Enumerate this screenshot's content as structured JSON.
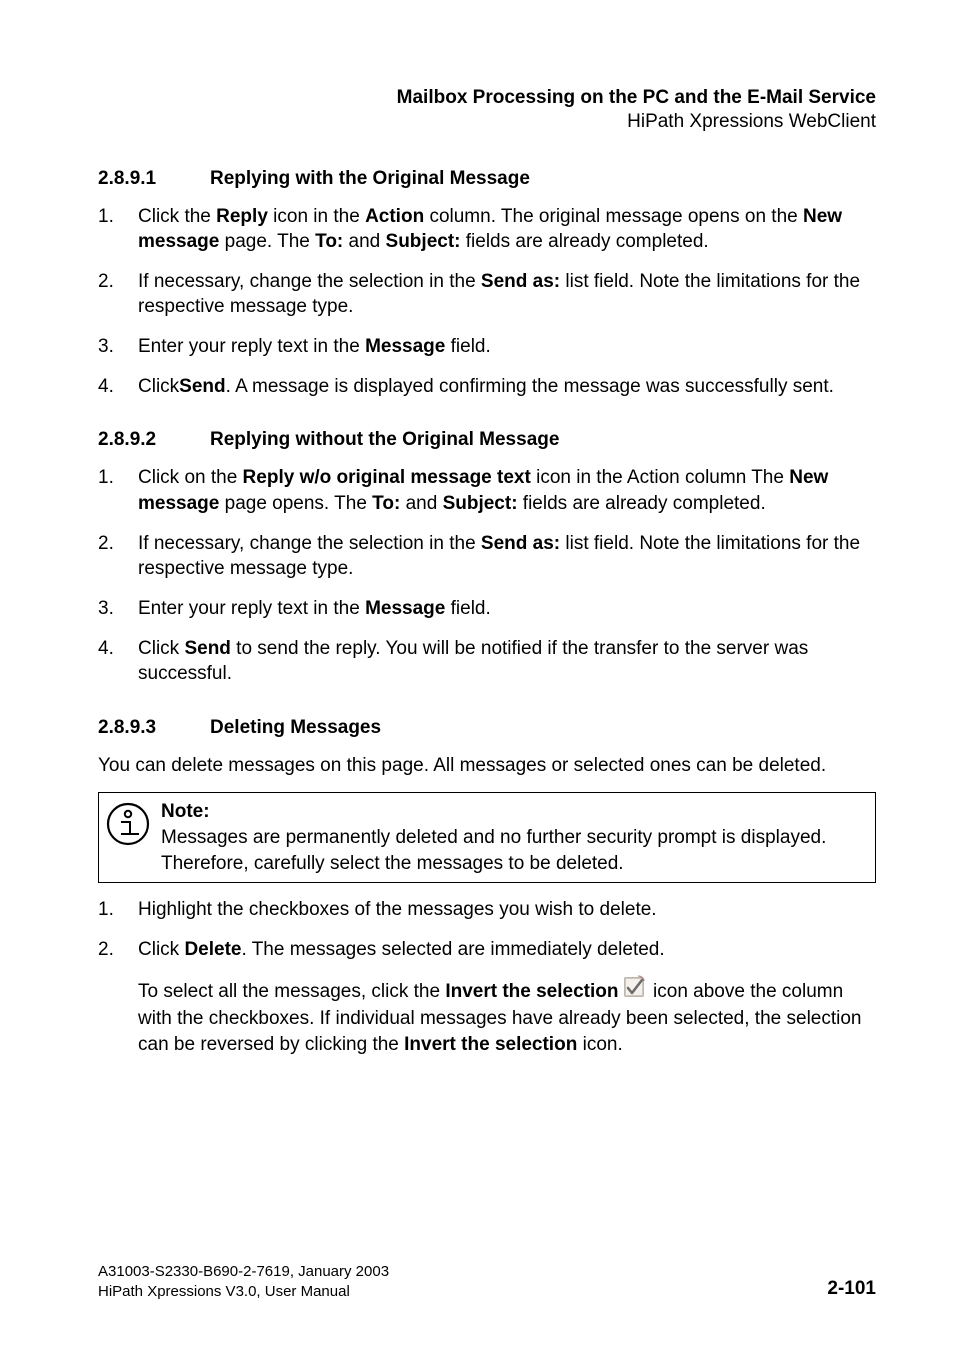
{
  "header": {
    "title": "Mailbox Processing on the PC and the E-Mail Service",
    "subtitle": "HiPath Xpressions WebClient"
  },
  "sections": {
    "s1": {
      "num": "2.8.9.1",
      "title": "Replying with the Original Message",
      "steps": [
        {
          "pre": "Click the ",
          "b1": "Reply",
          "mid1": " icon in the ",
          "b2": "Action",
          "mid2": " column. The original message opens on the ",
          "b3": "New message",
          "mid3": " page. The ",
          "b4": "To:",
          "mid4": " and ",
          "b5": "Subject:",
          "post": " fields are already completed."
        },
        {
          "pre": "If necessary, change the selection in the ",
          "b1": "Send as:",
          "post": " list field. Note the limitations for the respective message type."
        },
        {
          "pre": "Enter your reply text in the ",
          "b1": "Message",
          "post": " field."
        },
        {
          "pre": "Click",
          "b1": "Send",
          "post": ". A message is displayed confirming the message was successfully sent."
        }
      ]
    },
    "s2": {
      "num": "2.8.9.2",
      "title": "Replying without the Original Message",
      "steps": [
        {
          "pre": "Click on the ",
          "b1": "Reply w/o original message text",
          "mid1": " icon in the Action column The ",
          "b2": "New message",
          "mid2": " page opens. The ",
          "b3": "To:",
          "mid3": " and ",
          "b4": "Subject:",
          "post": " fields are already completed."
        },
        {
          "pre": "If necessary, change the selection in the ",
          "b1": "Send as:",
          "post": " list field. Note the limitations for the respective message type."
        },
        {
          "pre": "Enter your reply text in the ",
          "b1": "Message",
          "post": " field."
        },
        {
          "pre": "Click ",
          "b1": "Send",
          "post": " to send the reply. You will be notified if the transfer to the server was successful."
        }
      ]
    },
    "s3": {
      "num": "2.8.9.3",
      "title": "Deleting Messages",
      "intro": "You can delete messages on this page. All messages or selected ones can be deleted.",
      "note": {
        "label": "Note:",
        "body": "Messages are permanently deleted and no further security prompt is displayed. Therefore, carefully select the messages to be deleted."
      },
      "steps": [
        {
          "plain": "Highlight the checkboxes of the messages you wish to delete."
        },
        {
          "pre": "Click ",
          "b1": "Delete",
          "post": ". The messages selected are immediately deleted."
        }
      ],
      "tail": {
        "pre": "To select all the messages, click the ",
        "b1": "Invert the selection",
        "mid": "  icon above the column with the checkboxes. If individual messages have already been selected, the selection can be reversed by clicking the ",
        "b2": "Invert the selection",
        "post": " icon."
      }
    }
  },
  "footer": {
    "line1": "A31003-S2330-B690-2-7619, January 2003",
    "line2": "HiPath Xpressions V3.0, User Manual",
    "pagenum": "2-101"
  }
}
